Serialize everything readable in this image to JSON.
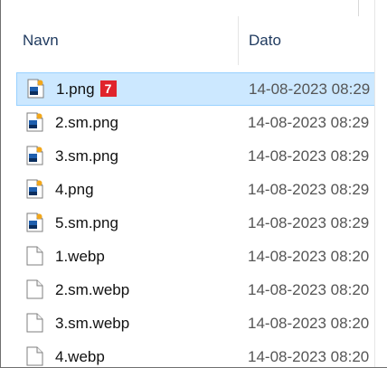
{
  "columns": {
    "name": "Navn",
    "date": "Dato"
  },
  "badge": "7",
  "files": [
    {
      "name": "1.png",
      "date": "14-08-2023 08:29",
      "type": "image",
      "selected": true
    },
    {
      "name": "2.sm.png",
      "date": "14-08-2023 08:29",
      "type": "image",
      "selected": false
    },
    {
      "name": "3.sm.png",
      "date": "14-08-2023 08:29",
      "type": "image",
      "selected": false
    },
    {
      "name": "4.png",
      "date": "14-08-2023 08:29",
      "type": "image",
      "selected": false
    },
    {
      "name": "5.sm.png",
      "date": "14-08-2023 08:29",
      "type": "image",
      "selected": false
    },
    {
      "name": "1.webp",
      "date": "14-08-2023 08:20",
      "type": "document",
      "selected": false
    },
    {
      "name": "2.sm.webp",
      "date": "14-08-2023 08:20",
      "type": "document",
      "selected": false
    },
    {
      "name": "3.sm.webp",
      "date": "14-08-2023 08:20",
      "type": "document",
      "selected": false
    },
    {
      "name": "4.webp",
      "date": "14-08-2023 08:20",
      "type": "document",
      "selected": false
    }
  ],
  "colors": {
    "selection_bg": "#cce8ff",
    "selection_border": "#99d1ff",
    "badge": "#e0242c",
    "header_text": "#1f3a5f"
  }
}
